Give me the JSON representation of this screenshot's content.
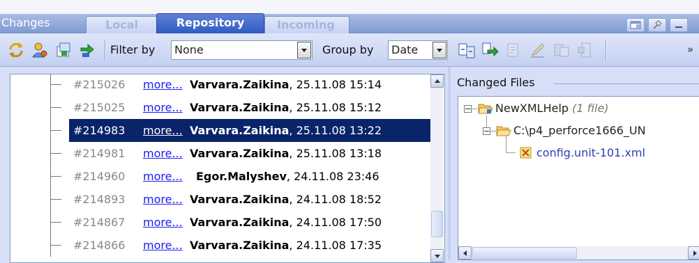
{
  "window": {
    "title": "Changes"
  },
  "tabs": [
    {
      "label": "Local",
      "active": false
    },
    {
      "label": "Repository",
      "active": true
    },
    {
      "label": "Incoming",
      "active": false
    }
  ],
  "toolbar": {
    "filter_label": "Filter by",
    "filter_value": "None",
    "group_label": "Group by",
    "group_value": "Date",
    "overflow": "»",
    "icons": [
      "refresh-icon",
      "user-settings-icon",
      "show-file-icon",
      "update-icon",
      "compare-icon",
      "merge-icon",
      "edit-icon",
      "pencil-icon",
      "annotate-icon",
      "revert-icon"
    ]
  },
  "changelists": [
    {
      "revision": "#215026",
      "more": "more...",
      "author": "Varvara.Zaikina",
      "datetime": ", 25.11.08 15:14",
      "selected": false
    },
    {
      "revision": "#215025",
      "more": "more...",
      "author": "Varvara.Zaikina",
      "datetime": ", 25.11.08 15:12",
      "selected": false
    },
    {
      "revision": "#214983",
      "more": "more...",
      "author": "Varvara.Zaikina",
      "datetime": ", 25.11.08 13:22",
      "selected": true
    },
    {
      "revision": "#214981",
      "more": "more...",
      "author": "Varvara.Zaikina",
      "datetime": ", 25.11.08 13:18",
      "selected": false
    },
    {
      "revision": "#214960",
      "more": "more...",
      "author": "Egor.Malyshev",
      "datetime": ", 24.11.08 23:46",
      "selected": false
    },
    {
      "revision": "#214893",
      "more": "more...",
      "author": "Varvara.Zaikina",
      "datetime": ", 24.11.08 18:52",
      "selected": false
    },
    {
      "revision": "#214867",
      "more": "more...",
      "author": "Varvara.Zaikina",
      "datetime": ", 24.11.08 17:50",
      "selected": false
    },
    {
      "revision": "#214866",
      "more": "more...",
      "author": "Varvara.Zaikina",
      "datetime": ", 24.11.08 17:35",
      "selected": false
    }
  ],
  "changed_files": {
    "title": "Changed Files",
    "root": {
      "label": "NewXMLHelp",
      "count": "(1 file)"
    },
    "folder": {
      "label": "C:\\p4_perforce1666_UN"
    },
    "file": {
      "label": "config.unit-101.xml"
    }
  },
  "colors": {
    "selection": "#0a246a",
    "link": "#1a1aff",
    "active_tab": "#2f5cc3"
  }
}
